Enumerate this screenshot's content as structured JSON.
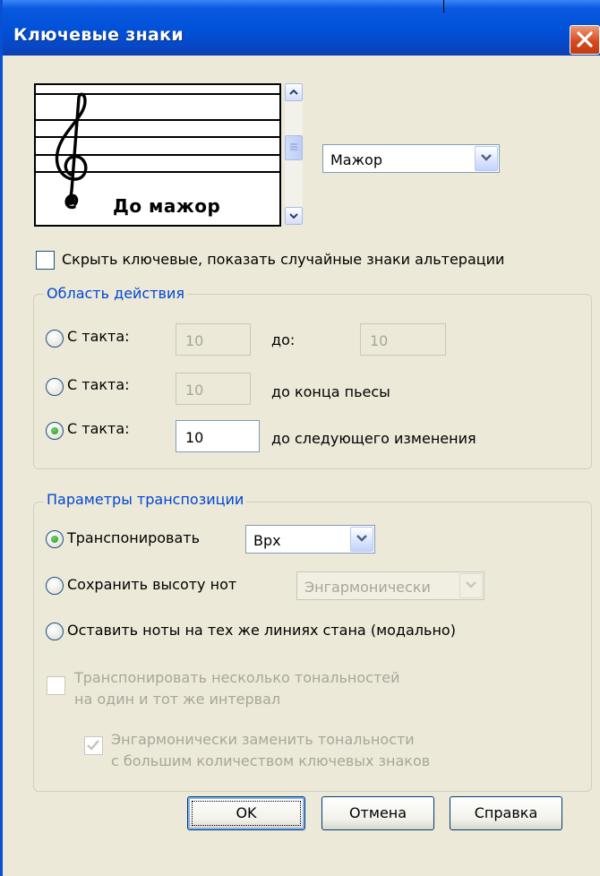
{
  "window": {
    "title": "Ключевые знаки",
    "close_icon": "close-icon"
  },
  "key_preview": {
    "key_name": "До мажор",
    "clef_icon": "treble-clef-icon"
  },
  "mode_select": {
    "value": "Мажор"
  },
  "hide_key_checkbox": {
    "label": "Скрыть ключевые, показать случайные знаки альтерации",
    "checked": false
  },
  "scope_group": {
    "legend": "Область действия",
    "options": [
      {
        "label": "С такта:",
        "from": "10",
        "middle": "до:",
        "to": "10",
        "selected": false
      },
      {
        "label": "С такта:",
        "from": "10",
        "middle": "до конца пьесы",
        "selected": false
      },
      {
        "label": "С такта:",
        "from": "10",
        "middle": "до следующего изменения",
        "selected": true
      }
    ]
  },
  "transpose_group": {
    "legend": "Параметры транспозиции",
    "transpose": {
      "label": "Транспонировать",
      "direction": "Врх",
      "selected": true
    },
    "keep_pitch": {
      "label": "Сохранить высоту нот",
      "spelling": "Энгармонически",
      "selected": false
    },
    "modal": {
      "label": "Оставить ноты на тех же линиях стана (модально)",
      "selected": false
    },
    "multi_keys": {
      "line1": "Транспонировать несколько тональностей",
      "line2": "на один и тот же интервал",
      "checked": false
    },
    "enharmonic": {
      "line1": "Энгармонически заменить тональности",
      "line2": "с большим количеством ключевых знаков",
      "checked": true
    }
  },
  "buttons": {
    "ok": "OK",
    "cancel": "Отмена",
    "help": "Справка"
  },
  "colors": {
    "titlebar": "#0050d8",
    "dialog_bg": "#ece9d8",
    "group_legend": "#0046d5",
    "radio_dot": "#1e9a16"
  }
}
